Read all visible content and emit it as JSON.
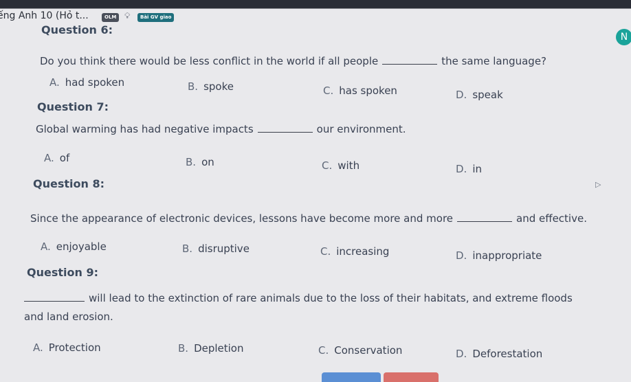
{
  "header": {
    "tab_title": "ếng Anh 10 (Hỏ t...",
    "chip_olm": "OLM",
    "hint_icon": "lightbulb-icon",
    "chip_gv": "Bài GV giao",
    "avatar_letter": "N"
  },
  "questions": [
    {
      "heading": "Question 6:",
      "before": "Do you think there would be less conflict in the world if all people",
      "after": "the same language?",
      "options": [
        {
          "letter": "A.",
          "text": "had spoken"
        },
        {
          "letter": "B.",
          "text": "spoke"
        },
        {
          "letter": "C.",
          "text": "has spoken"
        },
        {
          "letter": "D.",
          "text": "speak"
        }
      ]
    },
    {
      "heading": "Question 7:",
      "before": "Global warming has had negative impacts",
      "after": "our environment.",
      "options": [
        {
          "letter": "A.",
          "text": "of"
        },
        {
          "letter": "B.",
          "text": "on"
        },
        {
          "letter": "C.",
          "text": "with"
        },
        {
          "letter": "D.",
          "text": "in"
        }
      ]
    },
    {
      "heading": "Question 8:",
      "before": "Since the appearance of electronic devices, lessons have become more and more",
      "after": "and effective.",
      "options": [
        {
          "letter": "A.",
          "text": "enjoyable"
        },
        {
          "letter": "B.",
          "text": "disruptive"
        },
        {
          "letter": "C.",
          "text": "increasing"
        },
        {
          "letter": "D.",
          "text": "inappropriate"
        }
      ]
    },
    {
      "heading": "Question 9:",
      "after": "will lead to the extinction of rare animals due to the loss of their habitats, and extreme floods",
      "line2": "and land erosion.",
      "options": [
        {
          "letter": "A.",
          "text": "Protection"
        },
        {
          "letter": "B.",
          "text": "Depletion"
        },
        {
          "letter": "C.",
          "text": "Conservation"
        },
        {
          "letter": "D.",
          "text": "Deforestation"
        }
      ]
    }
  ]
}
